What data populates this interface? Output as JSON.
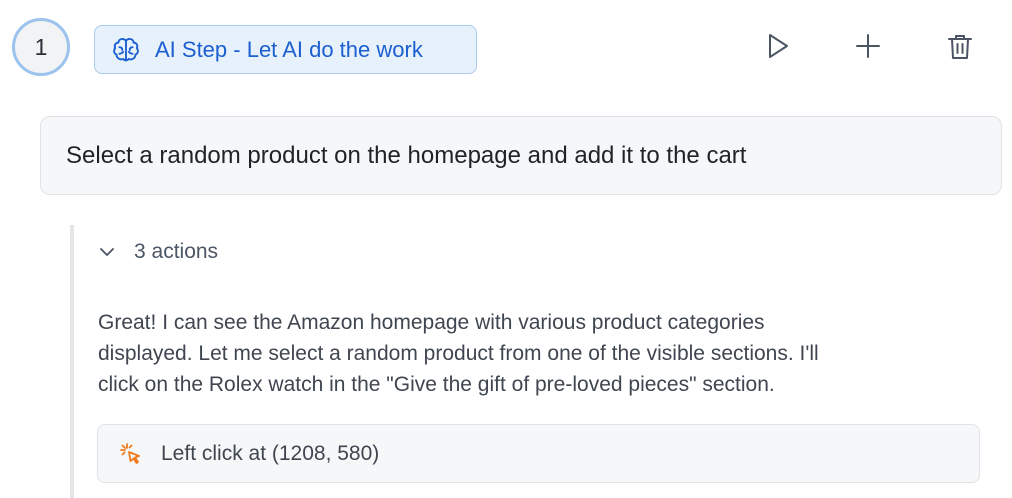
{
  "step": {
    "number": "1",
    "badge_label": "AI Step - Let AI do the work",
    "badge_icon": "brain-icon",
    "accent_color": "#1b5fd0"
  },
  "toolbar": {
    "run_icon": "play-icon",
    "add_icon": "plus-icon",
    "delete_icon": "trash-icon"
  },
  "prompt": {
    "text": "Select a random product on the homepage and add it to the cart"
  },
  "actions": {
    "toggle_label": "3 actions",
    "toggle_icon": "chevron-down-icon",
    "message_lines": [
      "Great! I can see the Amazon homepage with various product categories",
      "displayed. Let me select a random product from one of the visible sections. I'll",
      "click on the Rolex watch in the \"Give the gift of pre-loved pieces\" section."
    ],
    "items": [
      {
        "icon": "mouse-click-icon",
        "icon_color": "#f07b1d",
        "label": "Left click at (1208, 580)"
      }
    ]
  }
}
